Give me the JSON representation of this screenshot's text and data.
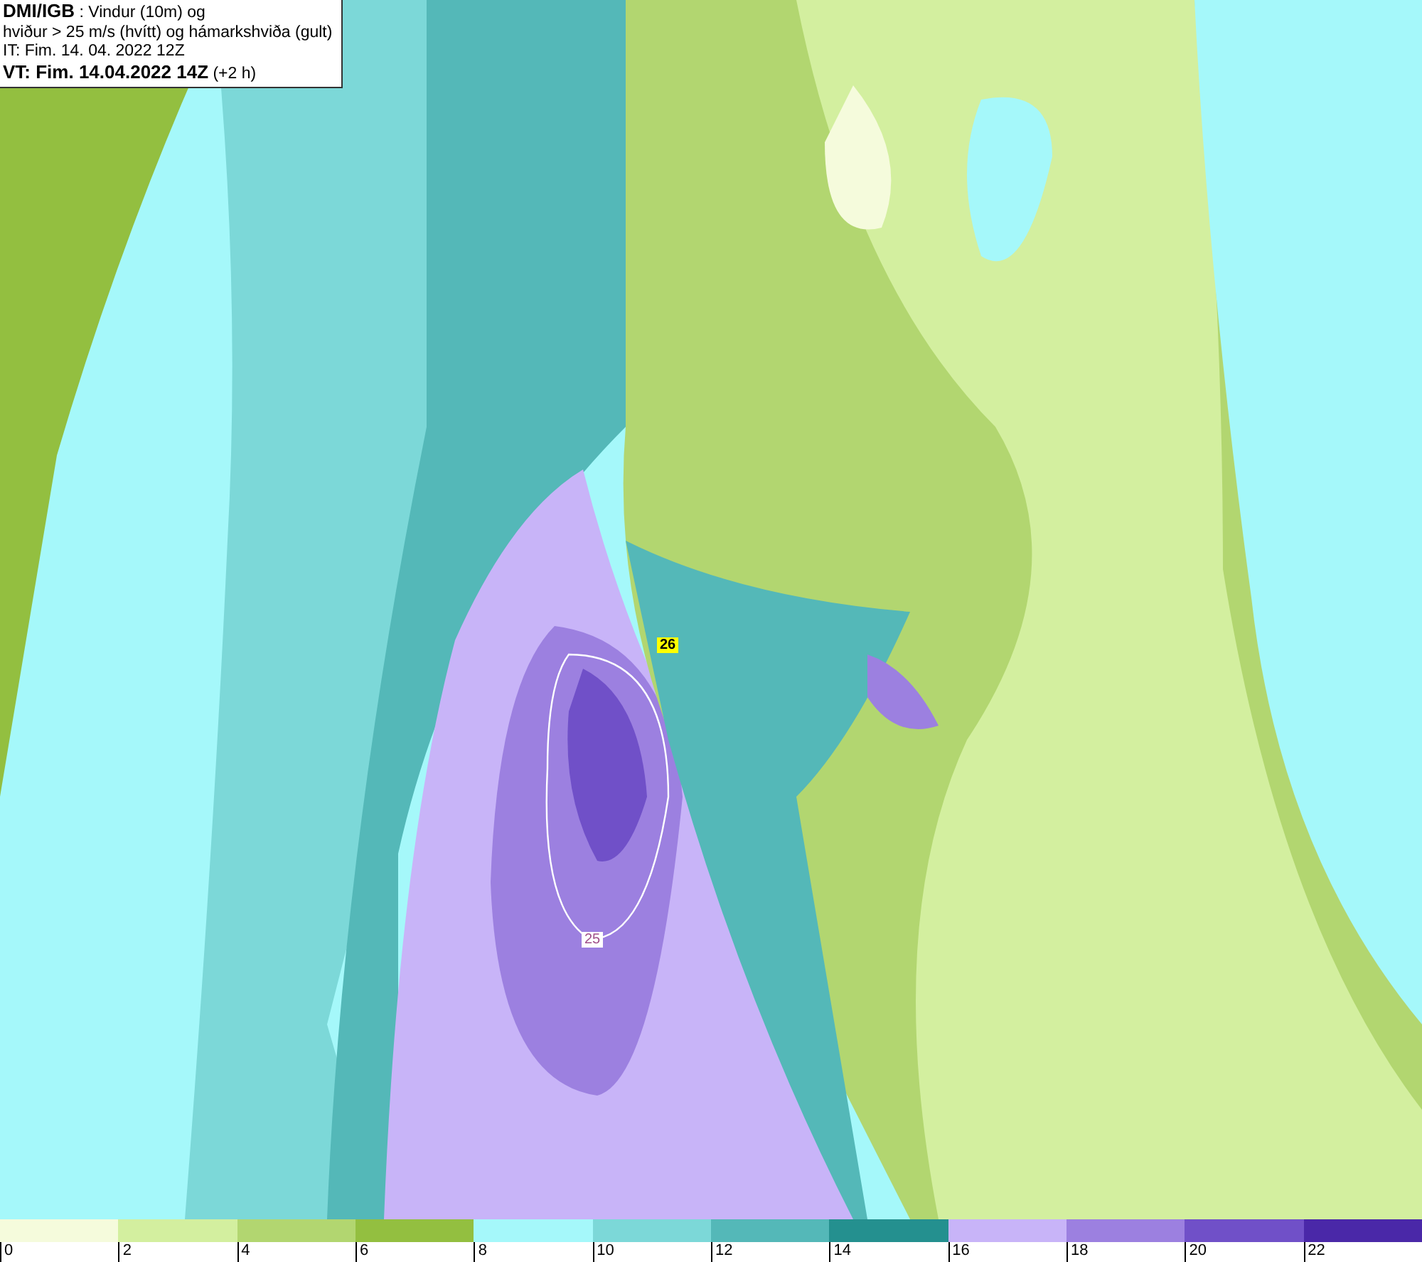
{
  "header": {
    "lines": [
      "**DMI/IGB** : Vindur (10m) og",
      "hviður > 25 m/s (hvítt) og hámarkshviða (gult)",
      "IT: Fim. 14. 04. 2022 12Z",
      "**VT: Fim. 14.04.2022 14Z** (+2 h)"
    ]
  },
  "map": {
    "labels": [
      {
        "text": "26",
        "kind": "max"
      },
      {
        "text": "25",
        "kind": "contour"
      }
    ]
  },
  "legend": [
    {
      "color": "#f5fbdc",
      "label": "0"
    },
    {
      "color": "#d3ef9f",
      "label": "2"
    },
    {
      "color": "#b2d670",
      "label": "4"
    },
    {
      "color": "#93bf40",
      "label": "6"
    },
    {
      "color": "#a5f8fa",
      "label": "8"
    },
    {
      "color": "#7cd8d8",
      "label": "10"
    },
    {
      "color": "#54b8b8",
      "label": "12"
    },
    {
      "color": "#24908f",
      "label": "14"
    },
    {
      "color": "#c8b4f8",
      "label": "16"
    },
    {
      "color": "#9c80e0",
      "label": "18"
    },
    {
      "color": "#7050c8",
      "label": "20"
    },
    {
      "color": "#4a28a8",
      "label": "22"
    }
  ]
}
